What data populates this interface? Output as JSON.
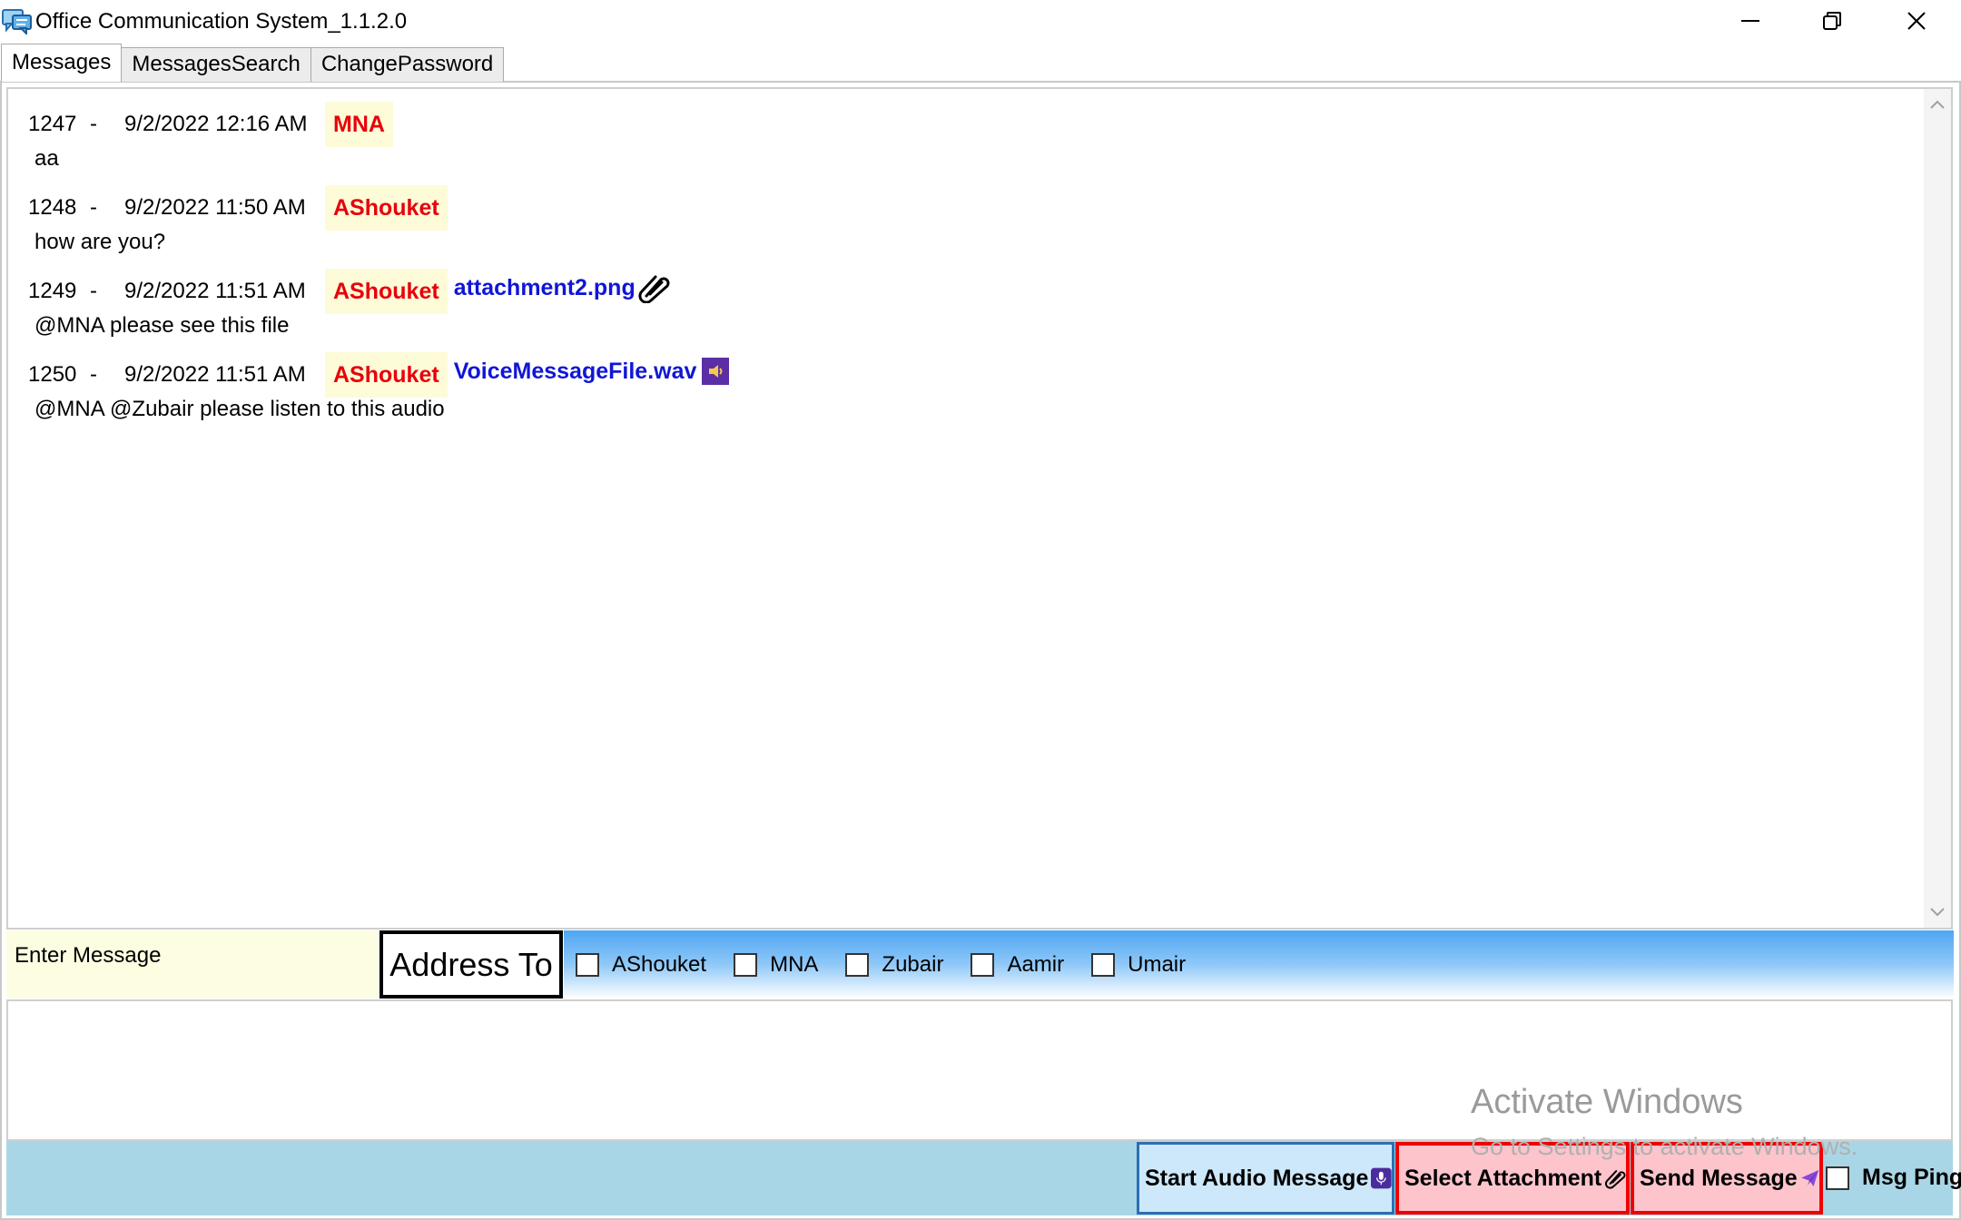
{
  "window": {
    "title": "Office Communication System_1.1.2.0"
  },
  "tabs": [
    {
      "label": "Messages",
      "active": true
    },
    {
      "label": "MessagesSearch",
      "active": false
    },
    {
      "label": "ChangePassword",
      "active": false
    }
  ],
  "messages": [
    {
      "id": "1247",
      "separator": "-",
      "date": "9/2/2022 12:16 AM",
      "sender": "MNA",
      "attachment": "",
      "attachment_type": "",
      "text": "aa"
    },
    {
      "id": "1248",
      "separator": "-",
      "date": "9/2/2022 11:50 AM",
      "sender": "AShouket",
      "attachment": "",
      "attachment_type": "",
      "text": "how are you?"
    },
    {
      "id": "1249",
      "separator": "-",
      "date": "9/2/2022 11:51 AM",
      "sender": "AShouket",
      "attachment": "attachment2.png",
      "attachment_type": "paperclip-icon",
      "text": "@MNA please see this file"
    },
    {
      "id": "1250",
      "separator": "-",
      "date": "9/2/2022 11:51 AM",
      "sender": "AShouket",
      "attachment": "VoiceMessageFile.wav",
      "attachment_type": "speaker-icon",
      "text": "@MNA @Zubair please listen to this audio"
    }
  ],
  "compose": {
    "enter_label": "Enter Message",
    "address_label": "Address To",
    "message_value": ""
  },
  "recipients": [
    {
      "name": "AShouket",
      "checked": false
    },
    {
      "name": "MNA",
      "checked": false
    },
    {
      "name": "Zubair",
      "checked": false
    },
    {
      "name": "Aamir",
      "checked": false
    },
    {
      "name": "Umair",
      "checked": false
    }
  ],
  "toolbar": {
    "audio_label": "Start Audio Message",
    "attach_label": "Select Attachment",
    "send_label": "Send Message",
    "ping_label": "Msg Ping",
    "ping_checked": false
  },
  "watermark": {
    "line1": "Activate Windows",
    "line2": "Go to Settings to activate Windows."
  },
  "colors": {
    "sender": "#e8000a",
    "attachment": "#1016d6",
    "sender_bg": "#fdfbd8",
    "toolbar_bg": "#a9d6e6",
    "danger_border": "#ef0000"
  }
}
